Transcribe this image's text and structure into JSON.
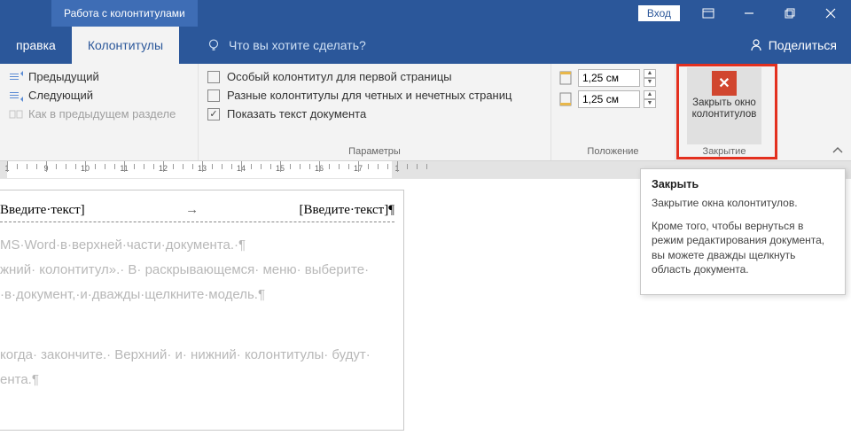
{
  "titlebar": {
    "context_tab": "Работа с колонтитулами",
    "signin": "Вход"
  },
  "tabs": {
    "prev": "правка",
    "active": "Колонтитулы",
    "tell_me": "Что вы хотите сделать?",
    "share": "Поделиться"
  },
  "ribbon": {
    "nav": {
      "previous": "Предыдущий",
      "next": "Следующий",
      "link_prev": "Как в предыдущем разделе"
    },
    "options": {
      "first_page": "Особый колонтитул для первой страницы",
      "odd_even": "Разные колонтитулы для четных и нечетных страниц",
      "show_text": "Показать текст документа",
      "group_label": "Параметры"
    },
    "position": {
      "top": "1,25 см",
      "bottom": "1,25 см",
      "group_label": "Положение"
    },
    "close": {
      "line1": "Закрыть окно",
      "line2": "колонтитулов",
      "group_label": "Закрытие"
    }
  },
  "tooltip": {
    "title": "Закрыть",
    "p1": "Закрытие окна колонтитулов.",
    "p2": "Кроме того, чтобы вернуться в режим редактирования документа, вы можете дважды щелкнуть область документа."
  },
  "doc": {
    "hf_left": "Введите·текст]",
    "hf_arrow": "→",
    "hf_right": "[Введите·текст]¶",
    "line1": "MS·Word·в·верхней·части·документа.·¶",
    "line2": "жний·  колонтитул».·  В·  раскрывающемся·  меню·  выберите·",
    "line3": "·в·документ,·и·дважды·щелкните·модель.¶",
    "line4": "когда·  закончите.·  Верхний·  и·  нижний·  колонтитулы·  будут·",
    "line5": "ента.¶"
  },
  "ruler": {
    "numbers": [
      "1",
      "9",
      "10",
      "11",
      "12",
      "13",
      "14",
      "15",
      "16",
      "17",
      "1"
    ]
  }
}
